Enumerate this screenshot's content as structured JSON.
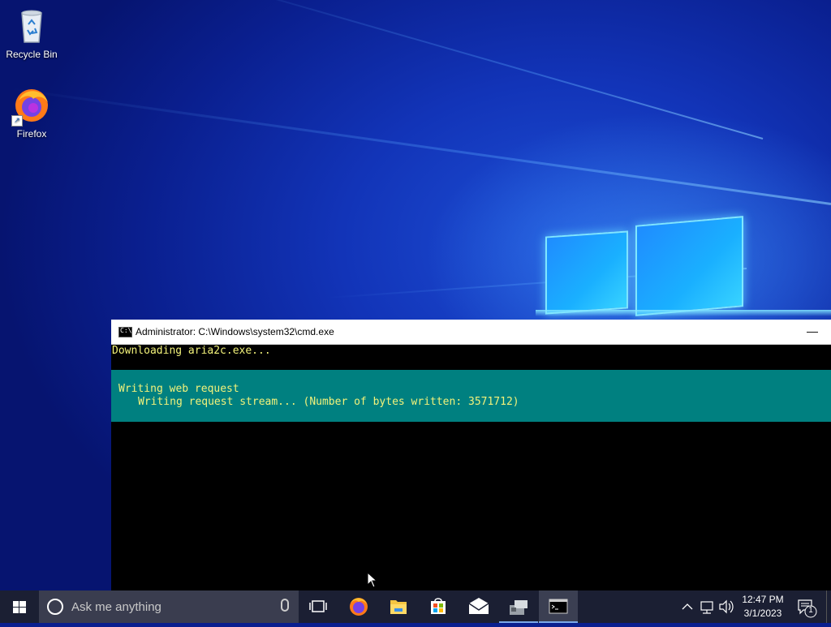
{
  "desktop": {
    "icons": [
      {
        "label": "Recycle Bin",
        "icon": "recycle-bin-icon"
      },
      {
        "label": "Firefox",
        "icon": "firefox-icon"
      }
    ]
  },
  "cmd_window": {
    "title": "Administrator: C:\\Windows\\system32\\cmd.exe",
    "minimize_glyph": "—",
    "lines": [
      "Downloading aria2c.exe..."
    ],
    "progress": {
      "line1": "Writing web request",
      "line2": "Writing request stream... (Number of bytes written: 3571712)"
    },
    "colors": {
      "text": "#f2f27a",
      "progress_bg": "#008080",
      "background": "#000000"
    }
  },
  "taskbar": {
    "search_placeholder": "Ask me anything",
    "apps": [
      {
        "name": "task-view",
        "icon": "task-view-icon"
      },
      {
        "name": "firefox",
        "icon": "firefox-icon"
      },
      {
        "name": "file-explorer",
        "icon": "folder-icon"
      },
      {
        "name": "store",
        "icon": "store-bag-icon"
      },
      {
        "name": "mail",
        "icon": "mail-icon"
      },
      {
        "name": "setup",
        "icon": "installer-icon"
      },
      {
        "name": "cmd",
        "icon": "console-icon"
      }
    ],
    "clock": {
      "time": "12:47 PM",
      "date": "3/1/2023"
    },
    "notification_count": "1"
  }
}
